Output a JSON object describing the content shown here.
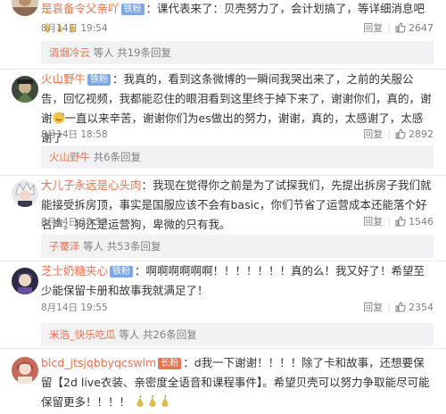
{
  "comments": [
    {
      "username": "是哀备令父亲吖",
      "badge": "铁粉",
      "text": "：课代表来了：贝壳努力了，会计划搞了，等详细消息吧",
      "date": "8月14日 19:54",
      "reply_label": "回复",
      "likes": "2647",
      "reply_user": "清烟冷云",
      "reply_summary": "等人 共19条回复"
    },
    {
      "username": "火山野牛",
      "badge": "铁粉",
      "text": "：我真的，看到这条微博的一瞬间我哭出来了，之前的关服公告，回忆视频，我都能忍住的眼泪看到这里终于掉下来了，谢谢你们，真的，谢谢",
      "text_after": "一直以来辛苦，谢谢你们为es做出的努力，谢谢，真的，太感谢了，太感谢了",
      "date": "8月14日 18:58",
      "reply_label": "回复",
      "likes": "2892",
      "reply_user": "火山野牛",
      "reply_summary": "共6条回复"
    },
    {
      "username": "大儿子永远是心头肉",
      "text": "：我现在觉得你之前是为了试探我们，先提出拆房子我们就能接受拆房顶，事实是国服应该不会有basic，你们节省了运营成本还能落个好名声。狗还是运营狗，卑微的只有我。",
      "date": "8月14日 19:50",
      "reply_label": "回复",
      "likes": "1546",
      "reply_user": "子騫泽",
      "reply_summary": "等人 共53条回复"
    },
    {
      "username": "芝士奶糖夹心",
      "badge": "铁粉",
      "text": "：啊啊啊啊啊啊！！！！！！！真的么！我又好了！希望至少能保留卡册和故事我就满足了！",
      "date": "8月14日 19:55",
      "reply_label": "回复",
      "likes": "2354",
      "reply_user": "米浩_快乐吃瓜",
      "reply_summary": "等人 共26条回复"
    },
    {
      "username": "blcd_jtsjqbbyqcswlm",
      "badge": "长粉",
      "text": "：d我一下谢谢！！！！除了卡和故事，还想要保留【2d live衣装、亲密度全语音和课程事件】。希望贝壳可以努力争取能尽可能保留更多！！！！"
    }
  ],
  "colors": {
    "accent": "#eb7350",
    "badge": "#7da8e8",
    "meta": "#808080",
    "replybar": "#f2f2f5"
  },
  "icons": {
    "like": "thumbs-up-icon",
    "emoji_praying": "praying-hands-emoji",
    "emoji_sweat": "sweat-smile-emoji",
    "emoji_pear": "pear-emoji"
  }
}
